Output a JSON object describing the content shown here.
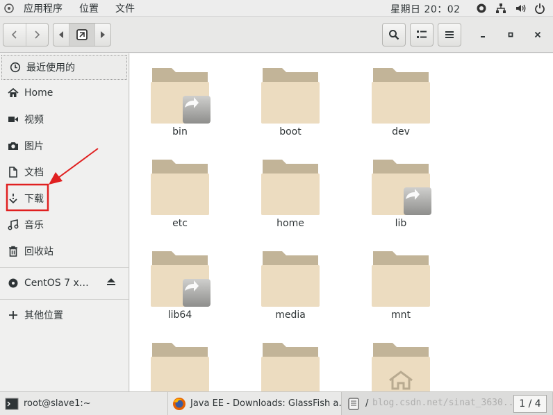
{
  "topbar": {
    "applications": "应用程序",
    "places": "位置",
    "files": "文件",
    "clock": "星期日 20：02"
  },
  "sidebar": {
    "items": [
      {
        "label": "最近使用的",
        "icon": "clock-icon"
      },
      {
        "label": "Home",
        "icon": "home-icon"
      },
      {
        "label": "视频",
        "icon": "video-icon"
      },
      {
        "label": "图片",
        "icon": "camera-icon"
      },
      {
        "label": "文档",
        "icon": "document-icon"
      },
      {
        "label": "下载",
        "icon": "download-icon"
      },
      {
        "label": "音乐",
        "icon": "music-icon"
      },
      {
        "label": "回收站",
        "icon": "trash-icon"
      }
    ],
    "devices": [
      {
        "label": "CentOS 7 x…",
        "icon": "disc-icon"
      }
    ],
    "other_locations": "其他位置"
  },
  "files": [
    {
      "name": "bin",
      "link": true
    },
    {
      "name": "boot",
      "link": false
    },
    {
      "name": "dev",
      "link": false
    },
    {
      "name": "etc",
      "link": false
    },
    {
      "name": "home",
      "link": false
    },
    {
      "name": "lib",
      "link": true
    },
    {
      "name": "lib64",
      "link": true
    },
    {
      "name": "media",
      "link": false
    },
    {
      "name": "mnt",
      "link": false
    }
  ],
  "taskbar": {
    "terminal": "root@slave1:~",
    "firefox": "Java EE - Downloads: GlassFish a…",
    "files_window": "/",
    "workspace": "1 / 4",
    "watermark": "blog.csdn.net/sinat_3630..."
  },
  "colors": {
    "folder_back": "#c2b498",
    "folder_front": "#ecdcc0",
    "annotation_red": "#e02020"
  }
}
